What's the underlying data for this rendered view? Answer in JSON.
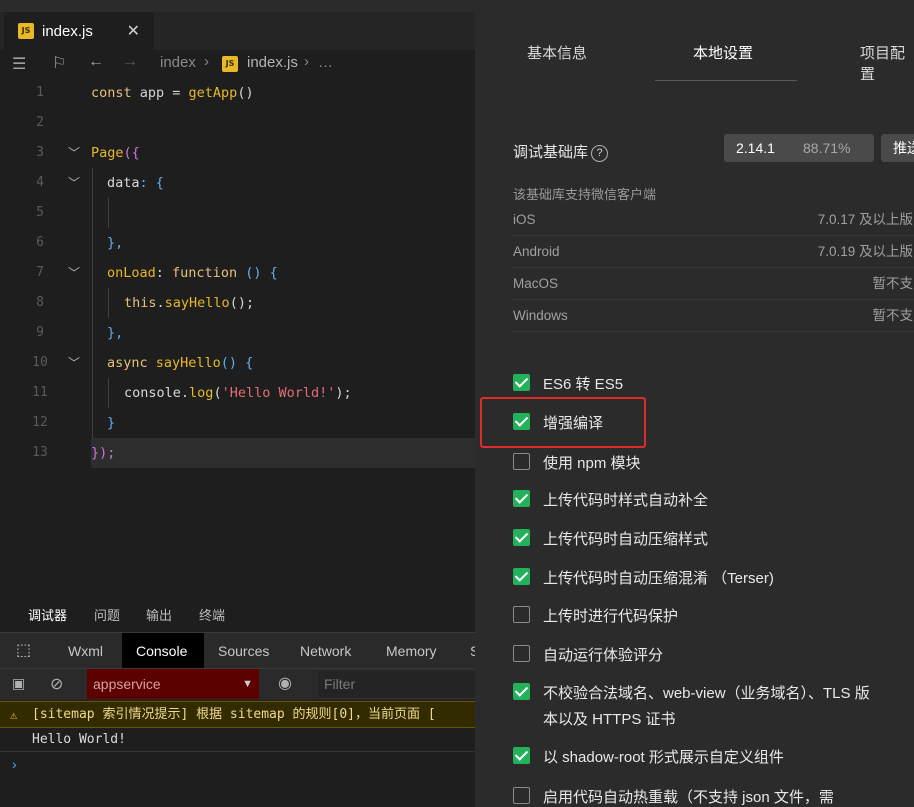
{
  "editor": {
    "tab": {
      "badge": "JS",
      "label": "index.js",
      "close": "✕"
    },
    "breadcrumb": {
      "root": "index",
      "file": "index.js",
      "more": "…"
    },
    "lines": [
      {
        "n": "1"
      },
      {
        "n": "2"
      },
      {
        "n": "3"
      },
      {
        "n": "4"
      },
      {
        "n": "5"
      },
      {
        "n": "6"
      },
      {
        "n": "7"
      },
      {
        "n": "8"
      },
      {
        "n": "9"
      },
      {
        "n": "10"
      },
      {
        "n": "11"
      },
      {
        "n": "12"
      },
      {
        "n": "13"
      }
    ],
    "code": {
      "l1_kw": "const",
      "l1_var": " app = ",
      "l1_fn": "getApp",
      "l1_end": "()",
      "l3_fn": "Page",
      "l3_end": "({",
      "l4_prop": "data",
      "l4_end": ": {",
      "l6": "},",
      "l7_fn": "onLoad",
      "l7_mid": ": ",
      "l7_kw": "function",
      "l7_end": " () {",
      "l8_this": "this",
      "l8_dot": ".",
      "l8_fn": "sayHello",
      "l8_end": "();",
      "l9": "},",
      "l10_kw": "async",
      "l10_fn": " sayHello",
      "l10_end": "() {",
      "l11_obj": "console",
      "l11_dot": ".",
      "l11_fn": "log",
      "l11_open": "(",
      "l11_str": "'Hello World!'",
      "l11_end": ");",
      "l12": "}",
      "l13": "});"
    }
  },
  "panel": {
    "tabs": [
      "调试器",
      "问题",
      "输出",
      "终端"
    ],
    "devtools_tabs": [
      "Wxml",
      "Console",
      "Sources",
      "Network",
      "Memory",
      "S"
    ],
    "context": "appservice",
    "filter_placeholder": "Filter",
    "warning": "[sitemap 索引情况提示] 根据 sitemap 的规则[0]，当前页面 [",
    "log": "Hello World!",
    "prompt": "›"
  },
  "settings": {
    "tabs": [
      "基本信息",
      "本地设置",
      "项目配置"
    ],
    "lib_label": "调试基础库",
    "help": "?",
    "version": "2.14.1",
    "percent": "88.71%",
    "push_btn": "推送",
    "support_text": "该基础库支持微信客户端",
    "os_rows": [
      {
        "os": "iOS",
        "val": "7.0.17 及以上版"
      },
      {
        "os": "Android",
        "val": "7.0.19 及以上版"
      },
      {
        "os": "MacOS",
        "val": "暂不支"
      },
      {
        "os": "Windows",
        "val": "暂不支"
      }
    ],
    "options": [
      {
        "label": "ES6 转 ES5",
        "checked": true
      },
      {
        "label": "增强编译",
        "checked": true
      },
      {
        "label": "使用 npm 模块",
        "checked": false
      },
      {
        "label": "上传代码时样式自动补全",
        "checked": true
      },
      {
        "label": "上传代码时自动压缩样式",
        "checked": true
      },
      {
        "label": "上传代码时自动压缩混淆 （Terser)",
        "checked": true
      },
      {
        "label": "上传时进行代码保护",
        "checked": false
      },
      {
        "label": "自动运行体验评分",
        "checked": false
      },
      {
        "label": "不校验合法域名、web-view（业务域名）、TLS 版",
        "label2": "本以及 HTTPS 证书",
        "checked": true
      },
      {
        "label": "以 shadow-root 形式展示自定义组件",
        "checked": true
      },
      {
        "label": "启用代码自动热重载（不支持 json 文件，需",
        "checked": false
      }
    ]
  },
  "colors": {
    "check_green": "#23b25b",
    "highlight_red": "#e02b2b",
    "context_bg": "#5c0000"
  }
}
